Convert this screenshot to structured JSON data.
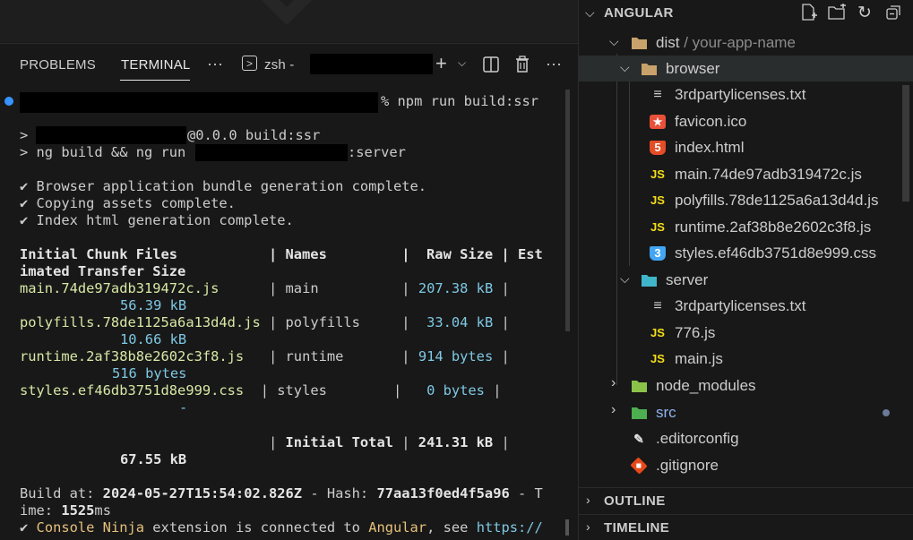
{
  "panel": {
    "tabs": [
      {
        "label": "PROBLEMS"
      },
      {
        "label": "TERMINAL"
      }
    ],
    "more_label": "···",
    "shell_label": "zsh -",
    "icons": [
      "terminal-icon",
      "add-icon",
      "chevron-down-icon",
      "split-icon",
      "trash-icon",
      "more-icon"
    ]
  },
  "terminal": {
    "prompt_cmd": "% npm run build:ssr",
    "line_pkg": "@0.0.0 build:ssr",
    "line_ng_prefix": "> ng build && ng run",
    "line_ng_suffix": ":server",
    "gt": ">",
    "check1": "✔ Browser application bundle generation complete.",
    "check2": "✔ Copying assets complete.",
    "check3": "✔ Index html generation complete.",
    "table_header1": "Initial Chunk Files           | Names         |  Raw Size | Est",
    "table_header2": "imated Transfer Size",
    "rows": [
      {
        "file": "main.74de97adb319472c.js",
        "sep1": "      | ",
        "name": "main",
        "sep2": "          | ",
        "raw": "207.38 kB",
        "sep3": " |",
        "transfer": "56.39 kB"
      },
      {
        "file": "polyfills.78de1125a6a13d4d.js",
        "sep1": " | ",
        "name": "polyfills",
        "sep2": "     |  ",
        "raw": "33.04 kB",
        "sep3": " |",
        "transfer": "10.66 kB"
      },
      {
        "file": "runtime.2af38b8e2602c3f8.js",
        "sep1": "   | ",
        "name": "runtime",
        "sep2": "       | ",
        "raw": "914 bytes",
        "sep3": " |",
        "transfer": "516 bytes"
      },
      {
        "file": "styles.ef46db3751d8e999.css",
        "sep1": "  | ",
        "name": "styles",
        "sep2": "        |   ",
        "raw": "0 bytes",
        "sep3": " |",
        "transfer": "-"
      }
    ],
    "total_sep": "                              | ",
    "total_label": "Initial Total",
    "total_mid": " | ",
    "total_raw": "241.31 kB",
    "total_end": " |",
    "total_transfer": "67.55 kB",
    "build_prefix": "Build at: ",
    "build_date": "2024-05-27T15:54:02.826Z",
    "build_hash_prefix": " - Hash: ",
    "build_hash": "77aa13f0ed4f5a96",
    "build_time_suffix1": " - T",
    "build_time_prefix2": "ime: ",
    "build_time": "1525",
    "build_time_unit": "ms",
    "ninja_check": "✔ ",
    "ninja_name": "Console Ninja",
    "ninja_mid": " extension is connected to ",
    "ninja_target": "Angular",
    "ninja_see": ", see ",
    "ninja_link": "https://"
  },
  "explorer": {
    "title": "ANGULAR",
    "header_icons": [
      "new-file-icon",
      "new-folder-icon",
      "refresh-icon",
      "collapse-all-icon"
    ],
    "dist_folder": "dist",
    "dist_sep": " / ",
    "app_folder": "your-app-name",
    "browser_folder": "browser",
    "browser_files": [
      {
        "name": "3rdpartylicenses.txt",
        "icon": "text-file-icon",
        "glyph": "≡",
        "color": "#cccccc"
      },
      {
        "name": "favicon.ico",
        "icon": "favicon-icon",
        "glyph": "★",
        "color": "#e8503a"
      },
      {
        "name": "index.html",
        "icon": "html-icon",
        "glyph": "5",
        "color": "#e44d26"
      },
      {
        "name": "main.74de97adb319472c.js",
        "icon": "js-icon",
        "glyph": "JS",
        "color": "#f5de19"
      },
      {
        "name": "polyfills.78de1125a6a13d4d.js",
        "icon": "js-icon",
        "glyph": "JS",
        "color": "#f5de19"
      },
      {
        "name": "runtime.2af38b8e2602c3f8.js",
        "icon": "js-icon",
        "glyph": "JS",
        "color": "#f5de19"
      },
      {
        "name": "styles.ef46db3751d8e999.css",
        "icon": "css-icon",
        "glyph": "3",
        "color": "#42a5f5"
      }
    ],
    "server_folder": "server",
    "server_files": [
      {
        "name": "3rdpartylicenses.txt",
        "icon": "text-file-icon",
        "glyph": "≡",
        "color": "#cccccc"
      },
      {
        "name": "776.js",
        "icon": "js-icon",
        "glyph": "JS",
        "color": "#f5de19"
      },
      {
        "name": "main.js",
        "icon": "js-icon",
        "glyph": "JS",
        "color": "#f5de19"
      }
    ],
    "node_modules": "node_modules",
    "src": "src",
    "editorconfig": ".editorconfig",
    "gitignore": ".gitignore",
    "outline": "OUTLINE",
    "timeline": "TIMELINE"
  }
}
